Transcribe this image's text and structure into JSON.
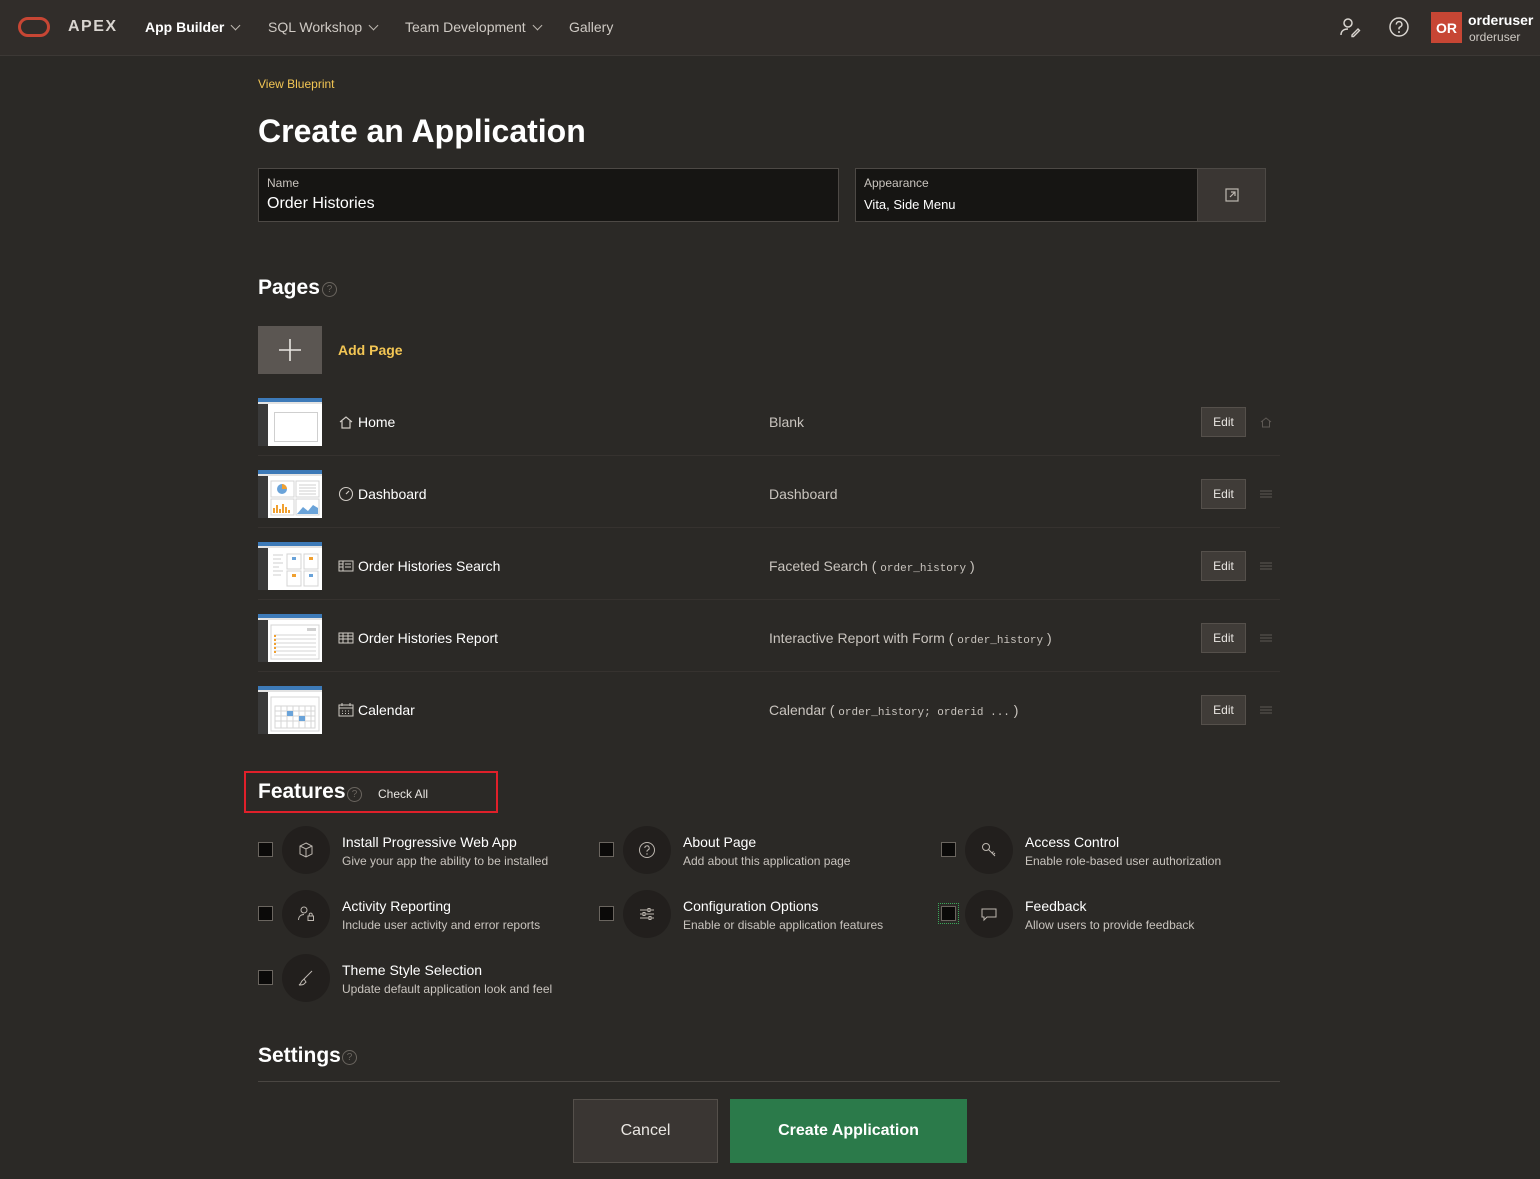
{
  "nav": {
    "brand": "APEX",
    "items": [
      "App Builder",
      "SQL Workshop",
      "Team Development",
      "Gallery"
    ],
    "user": {
      "initials": "OR",
      "name": "orderuser",
      "sub": "orderuser"
    },
    "brand_color": "#c74634"
  },
  "header": {
    "breadcrumb_link": "View Blueprint",
    "title": "Create an Application"
  },
  "name_field": {
    "label": "Name",
    "value": "Order Histories"
  },
  "appearance_field": {
    "label": "Appearance",
    "value": "Vita, Side Menu"
  },
  "pages": {
    "heading": "Pages",
    "add_label": "Add Page",
    "edit_label": "Edit",
    "rows": [
      {
        "name": "Home",
        "type": "Blank",
        "type_open": "",
        "detail": "",
        "type_close": "",
        "icon": "home-icon"
      },
      {
        "name": "Dashboard",
        "type": "Dashboard",
        "type_open": "",
        "detail": "",
        "type_close": "",
        "icon": "dashboard-gauge-icon"
      },
      {
        "name": "Order Histories Search",
        "type": "Faceted Search",
        "type_open": " ( ",
        "detail": "order_history",
        "type_close": " )",
        "icon": "faceted-search-icon"
      },
      {
        "name": "Order Histories Report",
        "type": "Interactive Report with Form",
        "type_open": " ( ",
        "detail": "order_history",
        "type_close": " )",
        "icon": "report-table-icon"
      },
      {
        "name": "Calendar",
        "type": "Calendar",
        "type_open": " ( ",
        "detail": "order_history; orderid ...",
        "type_close": " )",
        "icon": "calendar-icon"
      }
    ]
  },
  "features": {
    "heading": "Features",
    "check_all": "Check All",
    "items": [
      {
        "title": "Install Progressive Web App",
        "desc": "Give your app the ability to be installed",
        "icon": "package-box-icon"
      },
      {
        "title": "About Page",
        "desc": "Add about this application page",
        "icon": "question-circle-icon"
      },
      {
        "title": "Access Control",
        "desc": "Enable role-based user authorization",
        "icon": "key-icon"
      },
      {
        "title": "Activity Reporting",
        "desc": "Include user activity and error reports",
        "icon": "user-lock-icon"
      },
      {
        "title": "Configuration Options",
        "desc": "Enable or disable application features",
        "icon": "sliders-icon"
      },
      {
        "title": "Feedback",
        "desc": "Allow users to provide feedback",
        "icon": "comment-bubble-icon"
      },
      {
        "title": "Theme Style Selection",
        "desc": "Update default application look and feel",
        "icon": "paintbrush-icon"
      }
    ]
  },
  "settings": {
    "heading": "Settings"
  },
  "footer": {
    "cancel": "Cancel",
    "create": "Create Application",
    "create_color": "#2b7a4a"
  }
}
